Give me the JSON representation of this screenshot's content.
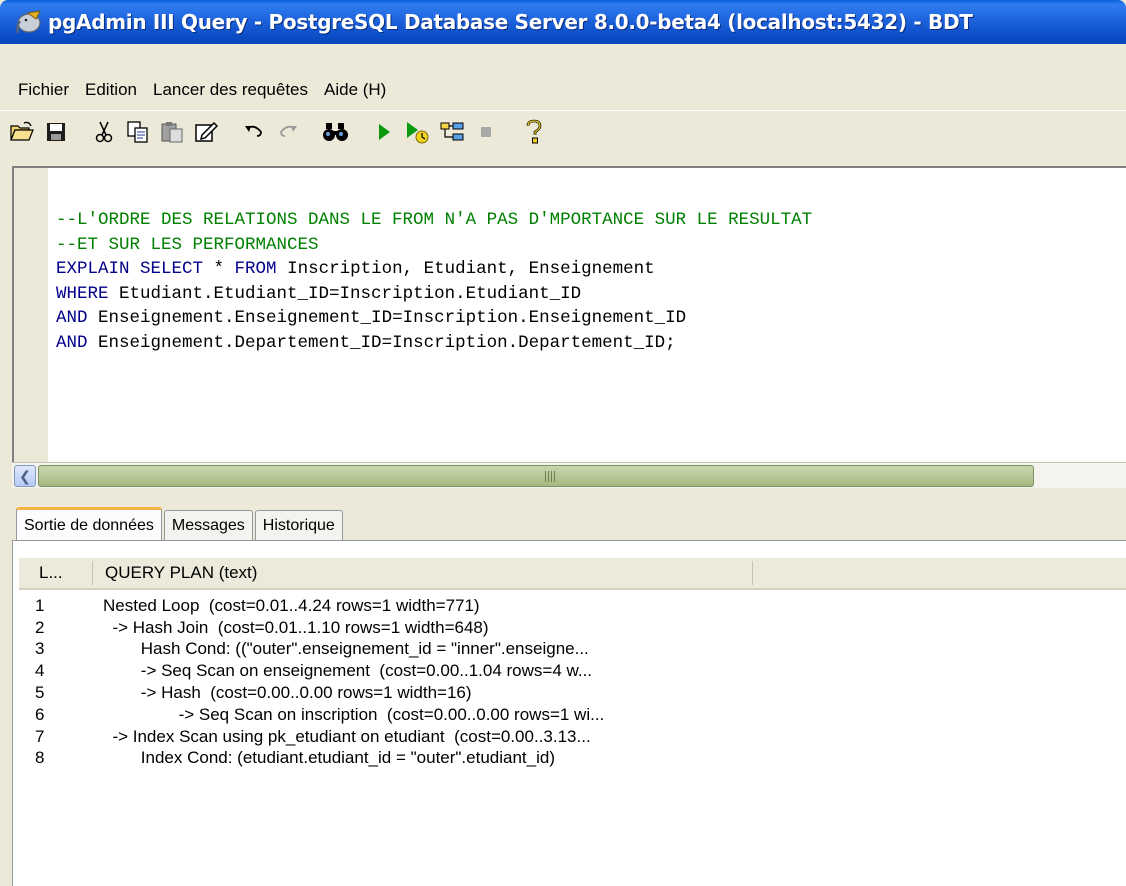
{
  "window": {
    "title": "pgAdmin III Query - PostgreSQL Database Server 8.0.0-beta4 (localhost:5432) - BDT"
  },
  "menu": [
    "Fichier",
    "Edition",
    "Lancer des requêtes",
    "Aide (H)"
  ],
  "toolbar": {
    "buttons": [
      {
        "name": "open-icon"
      },
      {
        "name": "save-icon"
      },
      {
        "name": "cut-icon"
      },
      {
        "name": "copy-icon"
      },
      {
        "name": "paste-icon"
      },
      {
        "name": "edit-icon"
      },
      {
        "name": "undo-icon"
      },
      {
        "name": "redo-icon"
      },
      {
        "name": "find-icon"
      },
      {
        "name": "execute-icon"
      },
      {
        "name": "explain-icon"
      },
      {
        "name": "execute-to-file-icon"
      },
      {
        "name": "stop-icon"
      },
      {
        "name": "help-icon"
      }
    ]
  },
  "editor": {
    "lines": [
      [
        {
          "t": "--L'ORDRE DES RELATIONS DANS LE FROM N'A PAS D'MPORTANCE SUR LE RESULTAT",
          "c": "comment"
        }
      ],
      [
        {
          "t": "--ET SUR LES PERFORMANCES",
          "c": "comment"
        }
      ],
      [
        {
          "t": "EXPLAIN SELECT",
          "c": "kw"
        },
        {
          "t": " * ",
          "c": ""
        },
        {
          "t": "FROM",
          "c": "kw"
        },
        {
          "t": " Inscription, Etudiant, Enseignement",
          "c": ""
        }
      ],
      [
        {
          "t": "WHERE",
          "c": "kw"
        },
        {
          "t": " Etudiant.Etudiant_ID=Inscription.Etudiant_ID",
          "c": ""
        }
      ],
      [
        {
          "t": "AND",
          "c": "kw"
        },
        {
          "t": " Enseignement.Enseignement_ID=Inscription.Enseignement_ID",
          "c": ""
        }
      ],
      [
        {
          "t": "AND",
          "c": "kw"
        },
        {
          "t": " Enseignement.Departement_ID=Inscription.Departement_ID;",
          "c": ""
        }
      ]
    ]
  },
  "tabs": [
    {
      "label": "Sortie de données",
      "active": true
    },
    {
      "label": "Messages",
      "active": false
    },
    {
      "label": "Historique",
      "active": false
    }
  ],
  "results": {
    "columns": [
      "L...",
      "QUERY PLAN (text)"
    ],
    "rows": [
      {
        "n": "1",
        "text": "Nested Loop  (cost=0.01..4.24 rows=1 width=771)"
      },
      {
        "n": "2",
        "text": "  -> Hash Join  (cost=0.01..1.10 rows=1 width=648)"
      },
      {
        "n": "3",
        "text": "        Hash Cond: ((\"outer\".enseignement_id = \"inner\".enseigne..."
      },
      {
        "n": "4",
        "text": "        -> Seq Scan on enseignement  (cost=0.00..1.04 rows=4 w..."
      },
      {
        "n": "5",
        "text": "        -> Hash  (cost=0.00..0.00 rows=1 width=16)"
      },
      {
        "n": "6",
        "text": "                -> Seq Scan on inscription  (cost=0.00..0.00 rows=1 wi..."
      },
      {
        "n": "7",
        "text": "  -> Index Scan using pk_etudiant on etudiant  (cost=0.00..3.13..."
      },
      {
        "n": "8",
        "text": "        Index Cond: (etudiant.etudiant_id = \"outer\".etudiant_id)"
      }
    ]
  }
}
